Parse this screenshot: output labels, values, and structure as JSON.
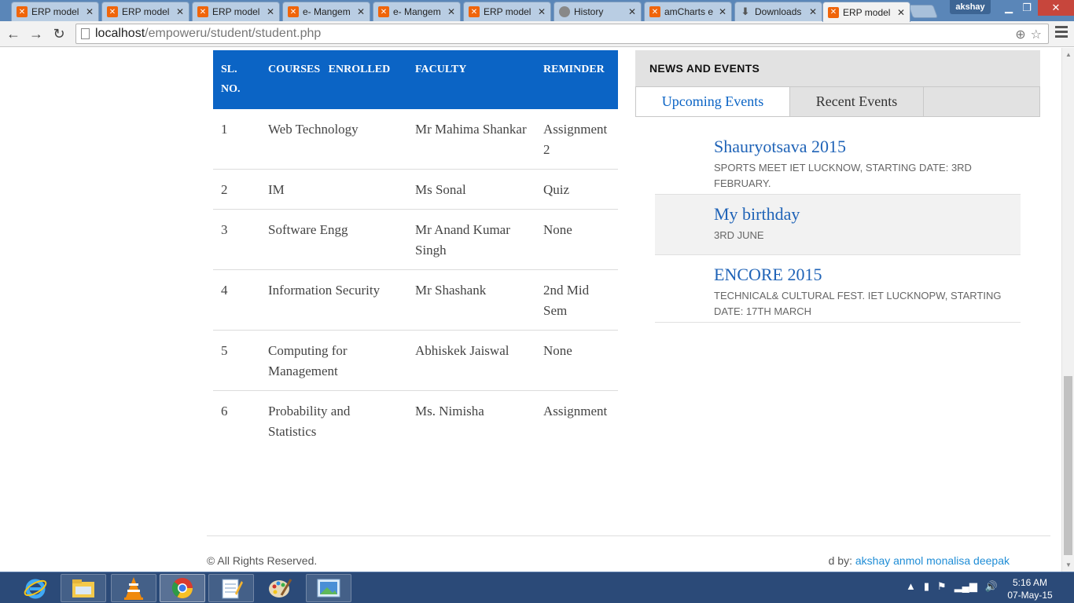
{
  "browser": {
    "tabs": [
      {
        "title": "ERP model",
        "icon": "xampp-icon",
        "left": 0
      },
      {
        "title": "ERP model",
        "icon": "xampp-icon"
      },
      {
        "title": "ERP model",
        "icon": "xampp-icon"
      },
      {
        "title": "e- Mangem",
        "icon": "xampp-icon"
      },
      {
        "title": "e- Mangem",
        "icon": "xampp-icon"
      },
      {
        "title": "ERP model",
        "icon": "xampp-icon"
      },
      {
        "title": "History",
        "icon": "history-icon"
      },
      {
        "title": "amCharts e",
        "icon": "xampp-icon"
      },
      {
        "title": "Downloads",
        "icon": "download-icon"
      },
      {
        "title": "ERP model",
        "icon": "xampp-icon",
        "active": true
      }
    ],
    "user": "akshay",
    "url_host": "localhost",
    "url_path": "/empoweru/student/student.php"
  },
  "courses": {
    "headers": {
      "sl": "SL. NO.",
      "course": "COURSES   ENROLLED",
      "faculty": "FACULTY",
      "reminder": "REMINDER"
    },
    "rows": [
      {
        "sl": "1",
        "course": "Web Technology",
        "faculty": "Mr Mahima Shankar",
        "reminder": "Assignment 2"
      },
      {
        "sl": "2",
        "course": "IM",
        "faculty": "Ms Sonal",
        "reminder": "Quiz"
      },
      {
        "sl": "3",
        "course": "Software Engg",
        "faculty": "Mr Anand Kumar Singh",
        "reminder": "None"
      },
      {
        "sl": "4",
        "course": "Information Security",
        "faculty": "Mr Shashank",
        "reminder": "2nd Mid Sem"
      },
      {
        "sl": "5",
        "course": "Computing for Management",
        "faculty": "Abhiskek Jaiswal",
        "reminder": "None"
      },
      {
        "sl": "6",
        "course": "Probability and Statistics",
        "faculty": "Ms. Nimisha",
        "reminder": "Assignment"
      }
    ]
  },
  "news": {
    "heading": "NEWS AND EVENTS",
    "tab_upcoming": "Upcoming Events",
    "tab_recent": "Recent Events",
    "events": [
      {
        "title": "Shauryotsava 2015",
        "desc": "SPORTS MEET IET LUCKNOW, STARTING DATE: 3RD FEBRUARY."
      },
      {
        "title": "My birthday",
        "desc": "3RD JUNE"
      },
      {
        "title": "ENCORE 2015",
        "desc": "TECHNICAL& CULTURAL FEST. IET LUCKNOPW, STARTING DATE: 17TH MARCH"
      }
    ]
  },
  "footer": {
    "copyright": "© All Rights Reserved.",
    "credits_prefix": "d by: ",
    "credits_names": "akshay anmol monalisa deepak"
  },
  "taskbar": {
    "time": "5:16 AM",
    "date": "07-May-15"
  },
  "colors": {
    "table_header": "#0b64c5",
    "event_title": "#1f63b7",
    "credits_link": "#1f8dd6"
  }
}
